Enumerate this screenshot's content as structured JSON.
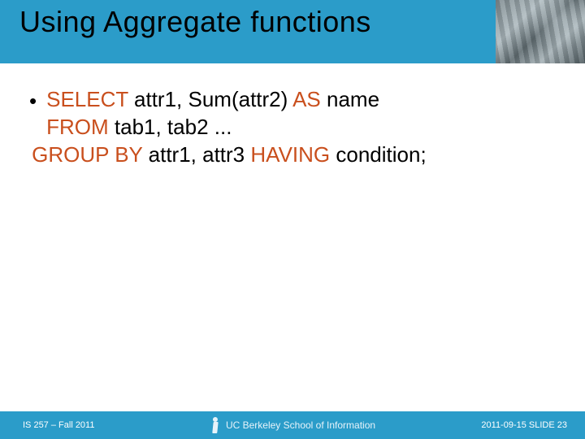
{
  "title": "Using Aggregate functions",
  "sql": {
    "select": "SELECT",
    "selectArgs": " attr1, Sum(attr2) ",
    "as": "AS",
    "asArgs": " name",
    "from": "FROM",
    "fromArgs": " tab1, tab2 ...",
    "groupby": "GROUP BY",
    "groupbyArgs": " attr1, attr3  ",
    "having": "HAVING",
    "havingArgs": " condition;"
  },
  "footer": {
    "left": "IS 257 – Fall 2011",
    "centerLabel": "UC Berkeley School of Information",
    "right": "2011-09-15 SLIDE 23"
  }
}
